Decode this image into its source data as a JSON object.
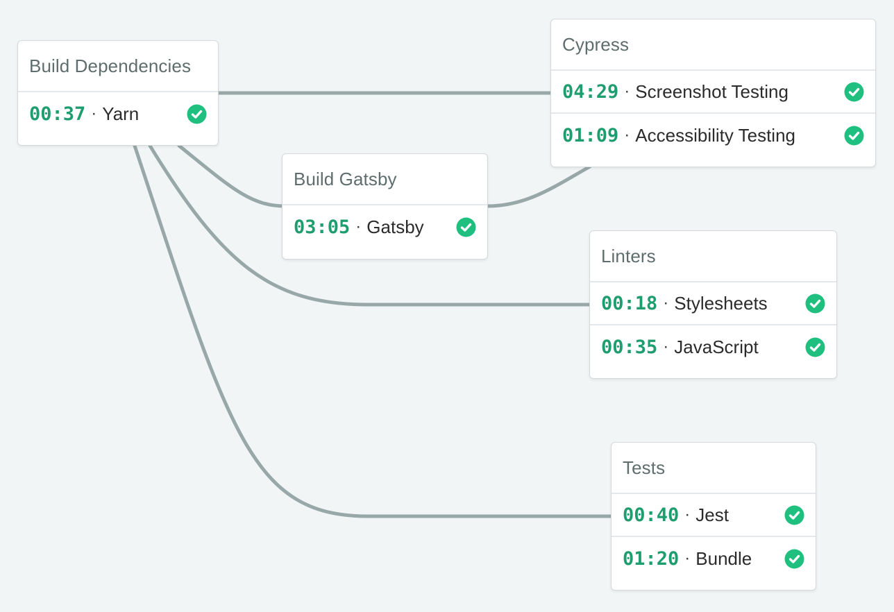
{
  "colors": {
    "background": "#f2f5f6",
    "connector": "#98a8a8",
    "duration_text": "#1e9e6f",
    "success_icon": "#1fc07f"
  },
  "stages": {
    "build_dependencies": {
      "title": "Build Dependencies",
      "jobs": [
        {
          "time": "00:37",
          "separator": "·",
          "name": "Yarn",
          "status_icon": "check-circle-icon"
        }
      ]
    },
    "build_gatsby": {
      "title": "Build Gatsby",
      "jobs": [
        {
          "time": "03:05",
          "separator": "·",
          "name": "Gatsby",
          "status_icon": "check-circle-icon"
        }
      ]
    },
    "cypress": {
      "title": "Cypress",
      "jobs": [
        {
          "time": "04:29",
          "separator": "·",
          "name": "Screenshot Testing",
          "status_icon": "check-circle-icon"
        },
        {
          "time": "01:09",
          "separator": "·",
          "name": "Accessibility Testing",
          "status_icon": "check-circle-icon"
        }
      ]
    },
    "linters": {
      "title": "Linters",
      "jobs": [
        {
          "time": "00:18",
          "separator": "·",
          "name": "Stylesheets",
          "status_icon": "check-circle-icon"
        },
        {
          "time": "00:35",
          "separator": "·",
          "name": "JavaScript",
          "status_icon": "check-circle-icon"
        }
      ]
    },
    "tests": {
      "title": "Tests",
      "jobs": [
        {
          "time": "00:40",
          "separator": "·",
          "name": "Jest",
          "status_icon": "check-circle-icon"
        },
        {
          "time": "01:20",
          "separator": "·",
          "name": "Bundle",
          "status_icon": "check-circle-icon"
        }
      ]
    }
  }
}
